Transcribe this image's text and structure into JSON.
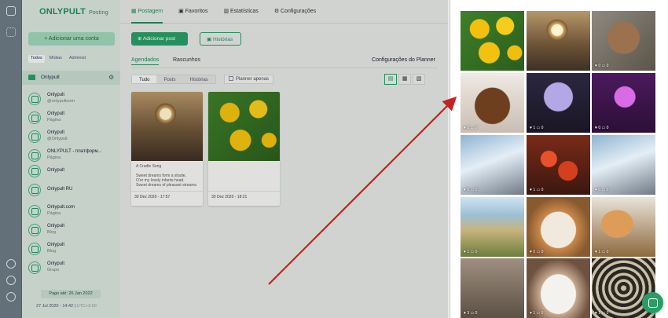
{
  "brand": {
    "name": "ONLYPULT",
    "tag": "Posting"
  },
  "sidebar": {
    "add_account": "Adicionar uma conta",
    "filters": [
      "Todos",
      "Mídias",
      "Administ"
    ],
    "project": "Onlypult",
    "accounts": [
      {
        "name": "Onlypult",
        "sub": "@onlypultcom"
      },
      {
        "name": "Onlypult",
        "sub": "Página"
      },
      {
        "name": "Onlypult",
        "sub": "@Onlypult"
      },
      {
        "name": "ONLYPULT - платформ...",
        "sub": "Página"
      },
      {
        "name": "Onlypult",
        "sub": ""
      },
      {
        "name": "Onlypult RU",
        "sub": ""
      },
      {
        "name": "Onlypult.com",
        "sub": "Página"
      },
      {
        "name": "Onlypult",
        "sub": "Blog"
      },
      {
        "name": "Onlypult",
        "sub": "Blog"
      },
      {
        "name": "Onlypult",
        "sub": "Grupo"
      }
    ],
    "paid_until": "Pago até: 26 Jan 2022",
    "datetime": "27 Jul 2020 - 14:42",
    "timezone": "UTC+3:00"
  },
  "nav": {
    "tabs": [
      "Postagem",
      "Favoritos",
      "Estatísticas",
      "Configurações"
    ],
    "active": "Postagem"
  },
  "toolbar": {
    "add_post": "Adicionar post",
    "stories": "Histórias"
  },
  "subtabs": {
    "scheduled": "Agendados",
    "drafts": "Rascunhos",
    "planner_config": "Configurações do Planner"
  },
  "filters": {
    "segments": [
      "Tudo",
      "Posts",
      "Histórias"
    ],
    "planner_only": "Planner apenas"
  },
  "cards": [
    {
      "caption_title": "A Cradle Song",
      "caption_lines": [
        "Sweet dreams form a shade,",
        "O'er my lovely infants head.",
        "Sweet dreams of pleasant streams"
      ],
      "timestamp": "30 Dez 2020 - 17:57"
    },
    {
      "caption_title": "",
      "caption_lines": [],
      "timestamp": "30 Dez 2020 - 18:21"
    }
  ],
  "grid": [
    {
      "likes": "",
      "comments": ""
    },
    {
      "likes": "",
      "comments": ""
    },
    {
      "likes": "0",
      "comments": "0"
    },
    {
      "likes": "0",
      "comments": "0"
    },
    {
      "likes": "1",
      "comments": "0"
    },
    {
      "likes": "0",
      "comments": "0"
    },
    {
      "likes": "0",
      "comments": "0"
    },
    {
      "likes": "1",
      "comments": "0"
    },
    {
      "likes": "0",
      "comments": "0"
    },
    {
      "likes": "1",
      "comments": "0"
    },
    {
      "likes": "0",
      "comments": "0"
    },
    {
      "likes": "1",
      "comments": "0"
    },
    {
      "likes": "3",
      "comments": "0"
    },
    {
      "likes": "1",
      "comments": "0"
    },
    {
      "likes": "1",
      "comments": "0"
    }
  ],
  "colors": {
    "accent": "#2a9c67",
    "arrow": "#c62222"
  }
}
